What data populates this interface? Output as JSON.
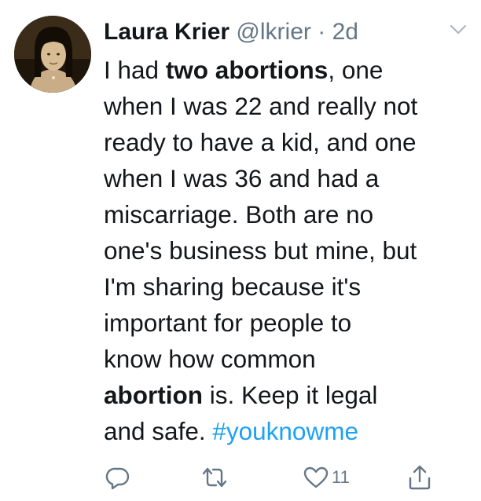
{
  "author": {
    "name": "Laura Krier",
    "handle": "@lkrier",
    "separator": "·",
    "time": "2d"
  },
  "tweet": {
    "line1_pre": "I had ",
    "line1_bold": "two abortions",
    "line1_post": ", one",
    "line2": "when I was 22 and really not",
    "line3": "ready to have a kid, and one",
    "line4": "when I was 36 and had a",
    "line5": "miscarriage. Both are no",
    "line6": "one's business but mine, but",
    "line7": "I'm sharing because it's",
    "line8": "important for people to",
    "line9": "know how common",
    "line10_bold": "abortion",
    "line10_post": " is. Keep it legal",
    "line11_pre": "and safe. ",
    "line11_hashtag": "#youknowme"
  },
  "actions": {
    "reply_icon": "reply-icon",
    "retweet_icon": "retweet-icon",
    "like_icon": "heart-icon",
    "like_count": "11",
    "share_icon": "share-icon"
  },
  "colors": {
    "text": "#14171a",
    "secondary": "#657786",
    "link": "#1da1f2"
  }
}
